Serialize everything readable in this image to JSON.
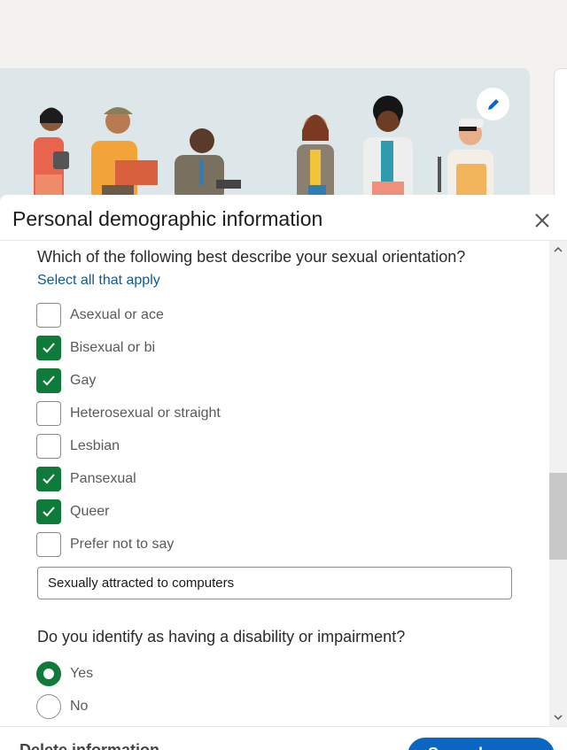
{
  "modal": {
    "title": "Personal demographic information"
  },
  "sections": {
    "orientation": {
      "question": "Which of the following best describe your sexual orientation?",
      "hint": "Select all that apply",
      "options": [
        {
          "label": "Asexual or ace",
          "checked": false
        },
        {
          "label": "Bisexual or bi",
          "checked": true
        },
        {
          "label": "Gay",
          "checked": true
        },
        {
          "label": "Heterosexual or straight",
          "checked": false
        },
        {
          "label": "Lesbian",
          "checked": false
        },
        {
          "label": "Pansexual",
          "checked": true
        },
        {
          "label": "Queer",
          "checked": true
        },
        {
          "label": "Prefer not to say",
          "checked": false
        }
      ],
      "other_value": "Sexually attracted to computers"
    },
    "disability": {
      "question": "Do you identify as having a disability or impairment?",
      "options": [
        {
          "label": "Yes",
          "selected": true
        },
        {
          "label": "No",
          "selected": false
        }
      ]
    }
  },
  "footer": {
    "delete_label": "Delete information",
    "save_label": "Save changes"
  },
  "colors": {
    "accent": "#0a66c2",
    "checked": "#0f7b3a",
    "link": "#0a5a9c"
  }
}
